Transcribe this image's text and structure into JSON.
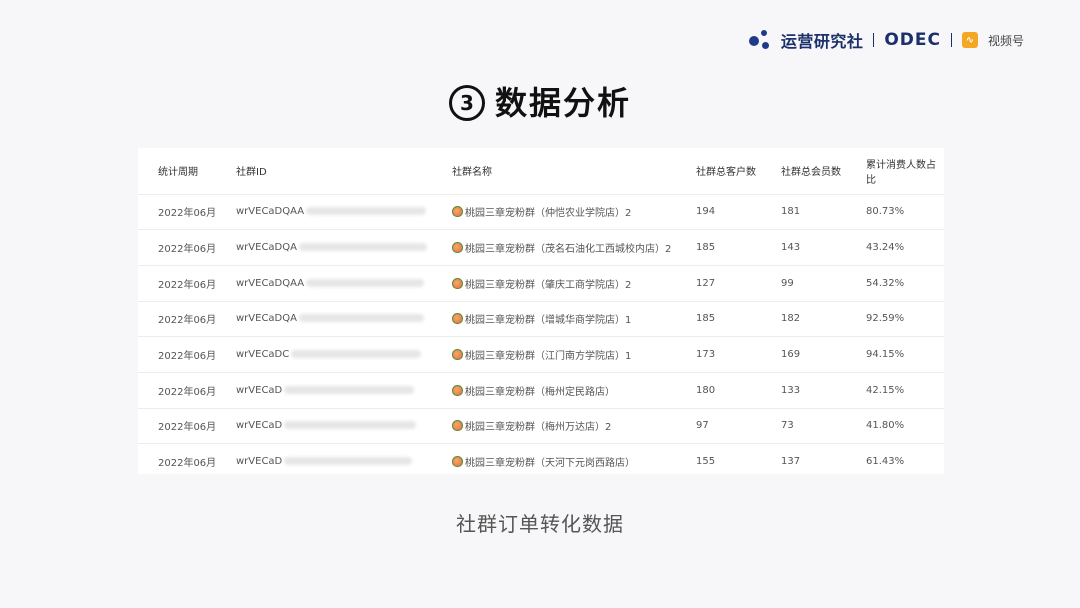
{
  "brand": {
    "org_name": "运营研究社",
    "odec": "ODEC",
    "channel": "视频号"
  },
  "title": {
    "number": "3",
    "text": "数据分析"
  },
  "table": {
    "headers": [
      "统计周期",
      "社群ID",
      "社群名称",
      "社群总客户数",
      "社群总会员数",
      "累计消费人数占比"
    ],
    "rows": [
      {
        "period": "2022年06月",
        "id": "wrVECaDQAA",
        "name": "桃园三章宠粉群（仲恺农业学院店）2",
        "customers": "194",
        "members": "181",
        "ratio": "80.73%"
      },
      {
        "period": "2022年06月",
        "id": "wrVECaDQA",
        "name": "桃园三章宠粉群（茂名石油化工西城校内店）2",
        "customers": "185",
        "members": "143",
        "ratio": "43.24%"
      },
      {
        "period": "2022年06月",
        "id": "wrVECaDQAA",
        "name": "桃园三章宠粉群（肇庆工商学院店）2",
        "customers": "127",
        "members": "99",
        "ratio": "54.32%"
      },
      {
        "period": "2022年06月",
        "id": "wrVECaDQA",
        "name": "桃园三章宠粉群（增城华商学院店）1",
        "customers": "185",
        "members": "182",
        "ratio": "92.59%"
      },
      {
        "period": "2022年06月",
        "id": "wrVECaDC",
        "name": "桃园三章宠粉群（江门南方学院店）1",
        "customers": "173",
        "members": "169",
        "ratio": "94.15%"
      },
      {
        "period": "2022年06月",
        "id": "wrVECaD",
        "name": "桃园三章宠粉群（梅州定民路店）",
        "customers": "180",
        "members": "133",
        "ratio": "42.15%"
      },
      {
        "period": "2022年06月",
        "id": "wrVECaD",
        "name": "桃园三章宠粉群（梅州万达店）2",
        "customers": "97",
        "members": "73",
        "ratio": "41.80%"
      },
      {
        "period": "2022年06月",
        "id": "wrVECaD",
        "name": "桃园三章宠粉群（天河下元岗西路店）",
        "customers": "155",
        "members": "137",
        "ratio": "61.43%"
      }
    ]
  },
  "caption": "社群订单转化数据"
}
